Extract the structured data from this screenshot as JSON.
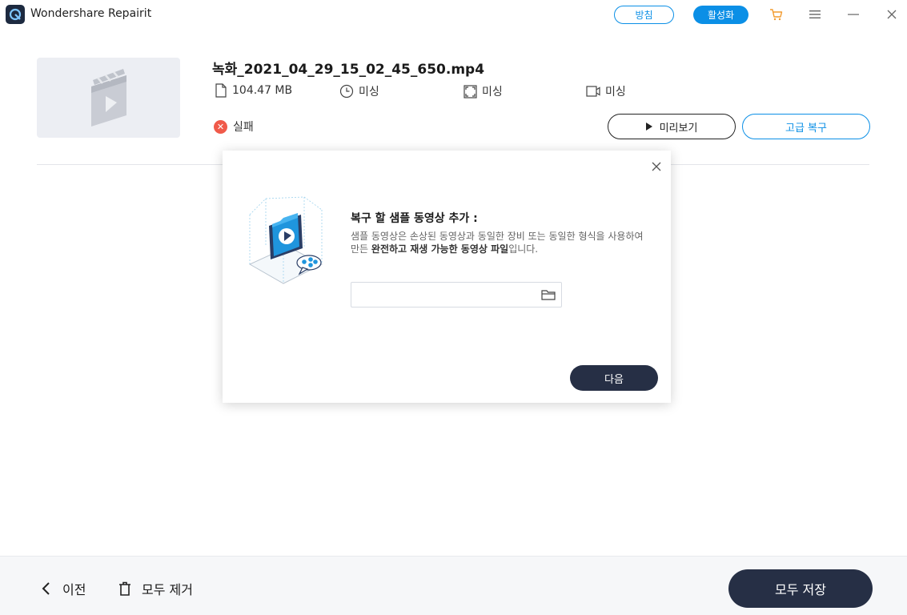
{
  "window": {
    "title": "Wondershare Repairit",
    "buy_label": "방침",
    "activate_label": "활성화",
    "cart_color": "#f29b2f",
    "accent_color": "#0b8fe6",
    "icons": [
      "cart-icon",
      "menu-icon",
      "minimize-icon",
      "close-icon"
    ]
  },
  "file": {
    "name": "녹화_2021_04_29_15_02_45_650.mp4",
    "size": "104.47  MB",
    "duration": "미싱",
    "resolution": "미싱",
    "codec": "미싱",
    "status": "실패",
    "status_color": "#f05a4a",
    "preview_label": "미리보기",
    "advanced_label": "고급 복구"
  },
  "dialog": {
    "title": "복구 할 샘플 동영상 추가 :",
    "desc_part1": "샘플 동영상은 손상된 동영상과 동일한 장비 또는 동일한 형식을 사용하여 만든 ",
    "desc_bold": "완전하고 재생 가능한 동영상 파일",
    "desc_part2": "입니다.",
    "path_value": "",
    "next_label": "다음"
  },
  "footer": {
    "back_label": "이전",
    "clear_label": "모두 제거",
    "save_all_label": "모두 저장",
    "dark_color": "#262f45"
  }
}
